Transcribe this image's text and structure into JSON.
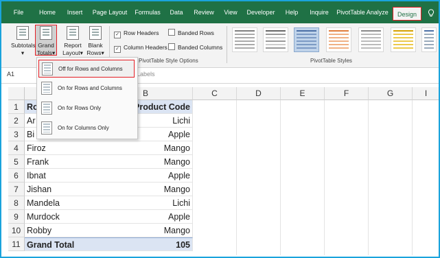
{
  "ribbon_tabs": [
    "File",
    "Home",
    "Insert",
    "Page Layout",
    "Formulas",
    "Data",
    "Review",
    "View",
    "Developer",
    "Help",
    "Inquire",
    "PivotTable Analyze",
    "Design"
  ],
  "ribbon": {
    "subtotals": "Subtotals",
    "grand_totals": [
      "Grand",
      "Totals"
    ],
    "report_layout": [
      "Report",
      "Layout"
    ],
    "blank_rows": [
      "Blank",
      "Rows"
    ],
    "row_headers": "Row Headers",
    "column_headers": "Column Headers",
    "banded_rows": "Banded Rows",
    "banded_columns": "Banded Columns",
    "style_options_group": "PivotTable Style Options",
    "styles_group": "PivotTable Styles"
  },
  "formula_bar": {
    "name_box": "A1",
    "value": "w Labels"
  },
  "columns": [
    "A",
    "B",
    "C",
    "D",
    "E",
    "F",
    "G"
  ],
  "rows": [
    {
      "num": "1",
      "a": "Ro",
      "b": "Product Code"
    },
    {
      "num": "2",
      "a": "Ar",
      "b": "Lichi"
    },
    {
      "num": "3",
      "a": "Bi",
      "b": "Apple"
    },
    {
      "num": "4",
      "a": "Firoz",
      "b": "Mango"
    },
    {
      "num": "5",
      "a": "Frank",
      "b": "Mango"
    },
    {
      "num": "6",
      "a": "Ibnat",
      "b": "Apple"
    },
    {
      "num": "7",
      "a": "Jishan",
      "b": "Mango"
    },
    {
      "num": "8",
      "a": "Mandela",
      "b": "Lichi"
    },
    {
      "num": "9",
      "a": "Murdock",
      "b": "Apple"
    },
    {
      "num": "10",
      "a": "Robby",
      "b": "Mango"
    },
    {
      "num": "11",
      "a": "Grand Total",
      "b": "105"
    }
  ],
  "dropdown": [
    "Off for Rows and Columns",
    "On for Rows and Columns",
    "On for Rows Only",
    "On for Columns Only"
  ],
  "colors": {
    "excel_green": "#1f7145",
    "highlight_red": "#e51c23",
    "pivot_band": "#dbe4f3",
    "frame_blue": "#1aa3dc"
  }
}
